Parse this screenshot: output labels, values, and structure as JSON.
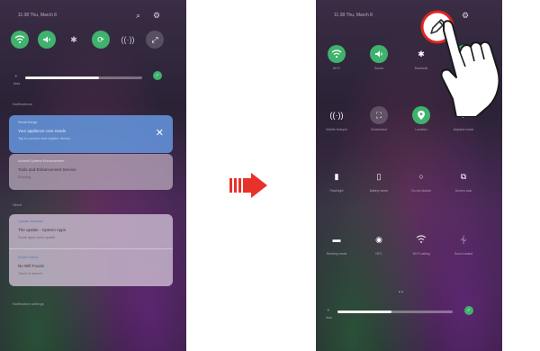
{
  "left_phone": {
    "status_time": "11:38 Thu, March 8",
    "quick_icons": [
      "wifi-icon",
      "sound-icon",
      "bluetooth-icon",
      "rotate-icon",
      "hotspot-icon",
      "expand-icon"
    ],
    "brightness_label": "Auto",
    "notifications_label": "Notifications",
    "notification_1": {
      "app": "Smart things",
      "title": "Your appliance care needs",
      "sub": "Tap to connect and register device"
    },
    "notification_2": {
      "app": "Android System Enhancement",
      "title": "Tools and Enhancement Service",
      "sub": "Running"
    },
    "silent_label": "Silent",
    "notification_3": {
      "app": "Update available",
      "title": "The update - System Apps",
      "sub": "Some apps need update"
    },
    "notification_4": {
      "app": "Smart Switch",
      "title": "No Wifi Found",
      "sub": "Touch to search"
    },
    "bottom_label": "Notification settings"
  },
  "right_phone": {
    "status_time": "11:38 Thu, March 8",
    "row1": [
      {
        "icon": "wifi-icon",
        "label": "Wi-Fi"
      },
      {
        "icon": "sound-icon",
        "label": "Sound"
      },
      {
        "icon": "bluetooth-icon",
        "label": "Bluetooth"
      },
      {
        "icon": "rotate-icon",
        "label": "Rotate"
      }
    ],
    "row2": [
      {
        "icon": "hotspot-icon",
        "label": "Mobile Hotspot"
      },
      {
        "icon": "screenshot-icon",
        "label": "Screenshot"
      },
      {
        "icon": "location-icon",
        "label": "Location"
      },
      {
        "icon": "airplane-icon",
        "label": "Airplane mode"
      }
    ],
    "row3": [
      {
        "icon": "flashlight-icon",
        "label": "Flashlight"
      },
      {
        "icon": "battery-icon",
        "label": "Battery saver"
      },
      {
        "icon": "dnd-icon",
        "label": "Do not disturb"
      },
      {
        "icon": "screencast-icon",
        "label": "Screen cast"
      }
    ],
    "row4": [
      {
        "icon": "reading-icon",
        "label": "Reading mode"
      },
      {
        "icon": "nfc-icon",
        "label": "NFC"
      },
      {
        "icon": "wifi-calling-icon",
        "label": "Wi-Fi calling"
      },
      {
        "icon": "sound-assist-icon",
        "label": "Sound assist"
      }
    ],
    "brightness_label": "Auto",
    "page_dots": "• •"
  },
  "colors": {
    "accent_green": "#3fb26d",
    "notif_blue": "#5b8fd6",
    "arrow_red": "#e8312a",
    "highlight_red": "#e0241b"
  }
}
